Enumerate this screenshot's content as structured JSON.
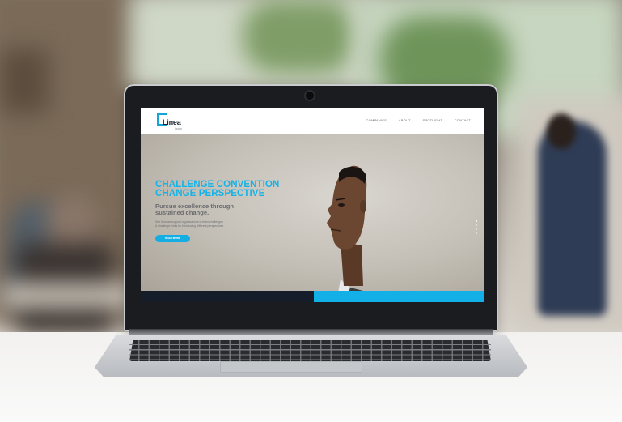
{
  "site": {
    "logo": {
      "name": "Linea",
      "sub": "Group"
    },
    "nav": [
      {
        "label": "COMPANIES ⌄"
      },
      {
        "label": "ABOUT ⌄"
      },
      {
        "label": "SPOTLIGHT ⌄"
      },
      {
        "label": "CONTACT ⌄"
      }
    ],
    "hero": {
      "title_line1": "CHALLENGE CONVENTION",
      "title_line2": "CHANGE PERSPECTIVE",
      "subtitle_line1": "Pursue excellence through",
      "subtitle_line2": "sustained change.",
      "body_line1": "See how we support organisations to learn challenges",
      "body_line2": "& challenge limits by introducing different perspectives",
      "button": "READ MORE"
    },
    "slider": {
      "count": 4,
      "active_index": 0
    }
  },
  "colors": {
    "accent": "#14aee3",
    "navy": "#151c2a",
    "title": "#16b3e8"
  }
}
